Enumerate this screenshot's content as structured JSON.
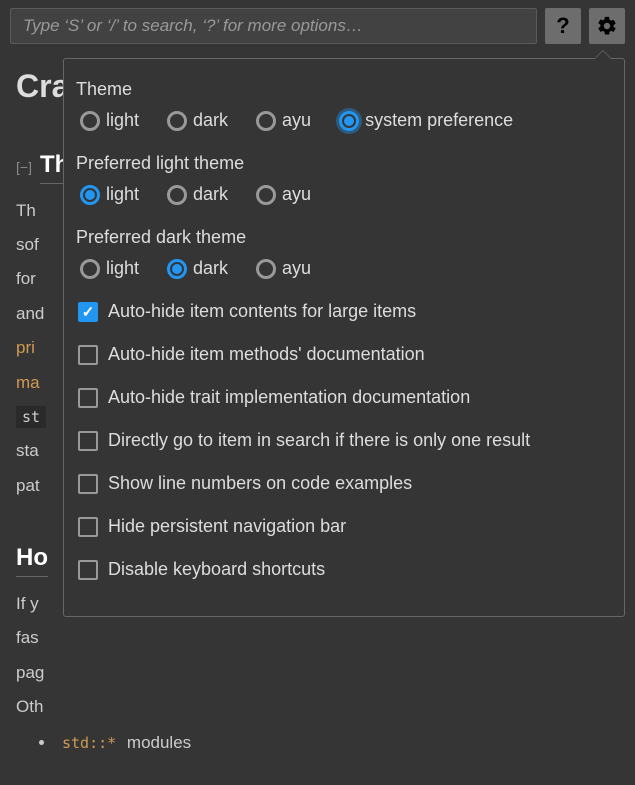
{
  "search": {
    "placeholder": "Type ‘S’ or ‘/’ to search, ‘?’ for more options…"
  },
  "help_button": "?",
  "bg": {
    "crate_title": "Crat",
    "section1": "Th",
    "p1": "Th",
    "p2": "sof",
    "p3": "for",
    "p4": "and",
    "link1": "pri",
    "link2": "ma",
    "code1": "st",
    "p5": "sta",
    "p6": "pat",
    "section2": "Ho",
    "p7": "If y",
    "p8": "fas",
    "p9": "pag",
    "p10": "Oth",
    "li1": "std::*",
    "li1_rest": " modules"
  },
  "settings": {
    "theme_label": "Theme",
    "theme_options": [
      "light",
      "dark",
      "ayu",
      "system preference"
    ],
    "theme_selected": 3,
    "light_label": "Preferred light theme",
    "light_options": [
      "light",
      "dark",
      "ayu"
    ],
    "light_selected": 0,
    "dark_label": "Preferred dark theme",
    "dark_options": [
      "light",
      "dark",
      "ayu"
    ],
    "dark_selected": 1,
    "checks": [
      {
        "label": "Auto-hide item contents for large items",
        "checked": true
      },
      {
        "label": "Auto-hide item methods' documentation",
        "checked": false
      },
      {
        "label": "Auto-hide trait implementation documentation",
        "checked": false
      },
      {
        "label": "Directly go to item in search if there is only one result",
        "checked": false
      },
      {
        "label": "Show line numbers on code examples",
        "checked": false
      },
      {
        "label": "Hide persistent navigation bar",
        "checked": false
      },
      {
        "label": "Disable keyboard shortcuts",
        "checked": false
      }
    ]
  }
}
